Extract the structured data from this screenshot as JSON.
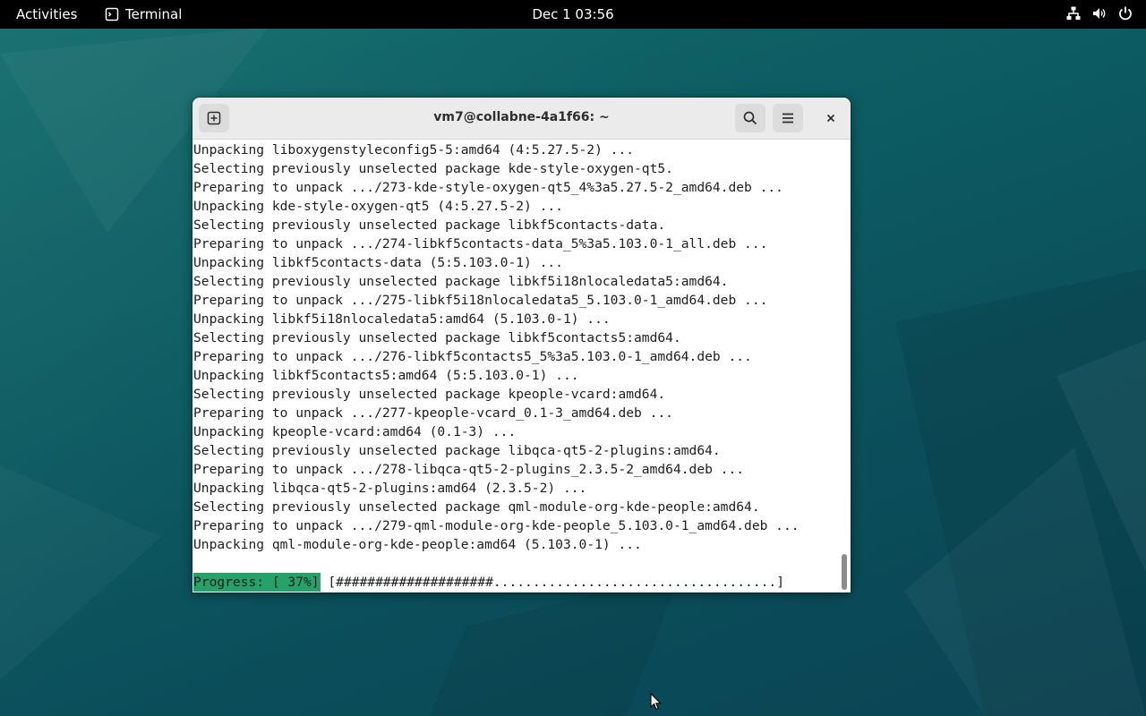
{
  "topbar": {
    "activities_label": "Activities",
    "app_name": "Terminal",
    "clock": "Dec 1  03:56",
    "status_icons": [
      "network-icon",
      "volume-icon",
      "power-icon"
    ]
  },
  "window": {
    "title": "vm7@collabne-4a1f66: ~",
    "buttons": {
      "new_tab": "new-tab-icon",
      "search": "search-icon",
      "menu": "hamburger-menu-icon",
      "close": "close-icon"
    }
  },
  "terminal": {
    "lines": [
      "Unpacking liboxygenstyleconfig5-5:amd64 (4:5.27.5-2) ...",
      "Selecting previously unselected package kde-style-oxygen-qt5.",
      "Preparing to unpack .../273-kde-style-oxygen-qt5_4%3a5.27.5-2_amd64.deb ...",
      "Unpacking kde-style-oxygen-qt5 (4:5.27.5-2) ...",
      "Selecting previously unselected package libkf5contacts-data.",
      "Preparing to unpack .../274-libkf5contacts-data_5%3a5.103.0-1_all.deb ...",
      "Unpacking libkf5contacts-data (5:5.103.0-1) ...",
      "Selecting previously unselected package libkf5i18nlocaledata5:amd64.",
      "Preparing to unpack .../275-libkf5i18nlocaledata5_5.103.0-1_amd64.deb ...",
      "Unpacking libkf5i18nlocaledata5:amd64 (5.103.0-1) ...",
      "Selecting previously unselected package libkf5contacts5:amd64.",
      "Preparing to unpack .../276-libkf5contacts5_5%3a5.103.0-1_amd64.deb ...",
      "Unpacking libkf5contacts5:amd64 (5:5.103.0-1) ...",
      "Selecting previously unselected package kpeople-vcard:amd64.",
      "Preparing to unpack .../277-kpeople-vcard_0.1-3_amd64.deb ...",
      "Unpacking kpeople-vcard:amd64 (0.1-3) ...",
      "Selecting previously unselected package libqca-qt5-2-plugins:amd64.",
      "Preparing to unpack .../278-libqca-qt5-2-plugins_2.3.5-2_amd64.deb ...",
      "Unpacking libqca-qt5-2-plugins:amd64 (2.3.5-2) ...",
      "Selecting previously unselected package qml-module-org-kde-people:amd64.",
      "Preparing to unpack .../279-qml-module-org-kde-people_5.103.0-1_amd64.deb ...",
      "Unpacking qml-module-org-kde-people:amd64 (5.103.0-1) ..."
    ],
    "progress": {
      "label": "Progress: [ 37%]",
      "bar": " [####################....................................]",
      "percent": 37
    },
    "accent_color": "#26a269"
  }
}
